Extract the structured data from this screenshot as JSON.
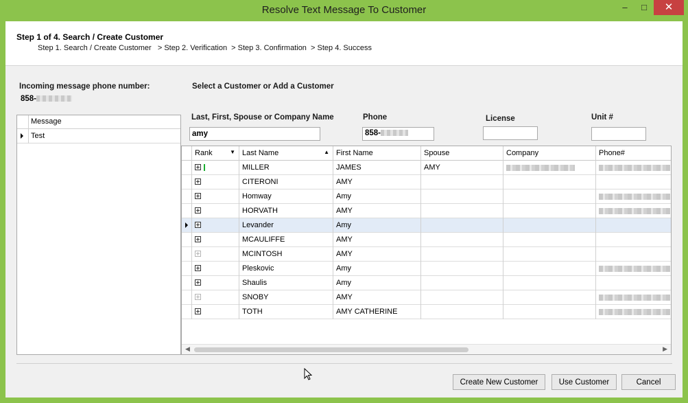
{
  "window": {
    "title": "Resolve Text Message To Customer",
    "controls": {
      "minimize": "–",
      "maximize": "□",
      "close": "✕"
    },
    "accent": "#8cc34c"
  },
  "wizard": {
    "step_title": "Step 1 of 4. Search / Create Customer",
    "step_path": "Step 1. Search / Create Customer   > Step 2. Verification  > Step 3. Confirmation  > Step 4. Success"
  },
  "incoming": {
    "label": "Incoming message phone number:",
    "phone_prefix": "858-"
  },
  "select_label": "Select a Customer or Add a Customer",
  "messages": {
    "header": "Message",
    "rows": [
      {
        "text": "Test"
      }
    ]
  },
  "search": {
    "name_label": "Last, First, Spouse or Company Name",
    "name_value": "amy",
    "phone_label": "Phone",
    "phone_value": "858-",
    "license_label": "License",
    "license_value": "",
    "unit_label": "Unit #",
    "unit_value": ""
  },
  "grid": {
    "columns": [
      "Rank",
      "Last Name",
      "First Name",
      "Spouse",
      "Company",
      "Phone#"
    ],
    "rows": [
      {
        "last": "MILLER",
        "first": "JAMES",
        "spouse": "AMY",
        "rank_bar": true,
        "dim": false,
        "selected": false,
        "company": true,
        "phone": true
      },
      {
        "last": "CITERONI",
        "first": "AMY",
        "spouse": "",
        "rank_bar": false,
        "dim": false,
        "selected": false,
        "company": false,
        "phone": false
      },
      {
        "last": "Homway",
        "first": "Amy",
        "spouse": "",
        "rank_bar": false,
        "dim": false,
        "selected": false,
        "company": false,
        "phone": true
      },
      {
        "last": "HORVATH",
        "first": "AMY",
        "spouse": "",
        "rank_bar": false,
        "dim": false,
        "selected": false,
        "company": false,
        "phone": true
      },
      {
        "last": "Levander",
        "first": "Amy",
        "spouse": "",
        "rank_bar": false,
        "dim": false,
        "selected": true,
        "company": false,
        "phone": false
      },
      {
        "last": "MCAULIFFE",
        "first": "AMY",
        "spouse": "",
        "rank_bar": false,
        "dim": false,
        "selected": false,
        "company": false,
        "phone": false
      },
      {
        "last": "MCINTOSH",
        "first": "AMY",
        "spouse": "",
        "rank_bar": false,
        "dim": true,
        "selected": false,
        "company": false,
        "phone": false
      },
      {
        "last": "Pleskovic",
        "first": "Amy",
        "spouse": "",
        "rank_bar": false,
        "dim": false,
        "selected": false,
        "company": false,
        "phone": true
      },
      {
        "last": "Shaulis",
        "first": "Amy",
        "spouse": "",
        "rank_bar": false,
        "dim": false,
        "selected": false,
        "company": false,
        "phone": false
      },
      {
        "last": "SNOBY",
        "first": "AMY",
        "spouse": "",
        "rank_bar": false,
        "dim": true,
        "selected": false,
        "company": false,
        "phone": true
      },
      {
        "last": "TOTH",
        "first": "AMY CATHERINE",
        "spouse": "",
        "rank_bar": false,
        "dim": false,
        "selected": false,
        "company": false,
        "phone": true
      }
    ]
  },
  "buttons": {
    "create": "Create New Customer",
    "use": "Use Customer",
    "cancel": "Cancel"
  }
}
